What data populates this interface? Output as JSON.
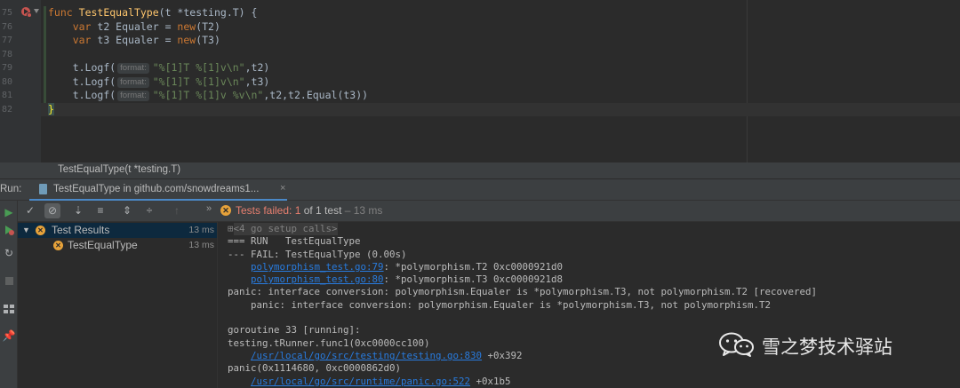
{
  "editor": {
    "line_numbers": [
      "75",
      "76",
      "77",
      "78",
      "79",
      "80",
      "81",
      "82"
    ],
    "line75": {
      "kw": "func",
      "name": "TestEqualType",
      "params": "(t *testing.T) {"
    },
    "line76": {
      "indent": "    ",
      "kw": "var",
      "rest": " t2 Equaler = ",
      "new": "new",
      "arg": "(T2)"
    },
    "line77": {
      "indent": "    ",
      "kw": "var",
      "rest": " t3 Equaler = ",
      "new": "new",
      "arg": "(T3)"
    },
    "line79": {
      "indent": "    ",
      "call": "t.Logf(",
      "hint": "format:",
      "str": "\"%[1]T %[1]v\\n\"",
      "tail": ",t2)"
    },
    "line80": {
      "indent": "    ",
      "call": "t.Logf(",
      "hint": "format:",
      "str": "\"%[1]T %[1]v\\n\"",
      "tail": ",t3)"
    },
    "line81": {
      "indent": "    ",
      "call": "t.Logf(",
      "hint": "format:",
      "str": "\"%[1]T %[1]v %v\\n\"",
      "tail": ",t2,t2.Equal(t3))"
    },
    "line82": {
      "brace": "}"
    }
  },
  "breadcrumb": {
    "text": "TestEqualType(t *testing.T)"
  },
  "run_panel": {
    "label": "Run:",
    "tab_label": "TestEqualType in github.com/snowdreams1...",
    "tab_close": "×"
  },
  "status": {
    "expand": "»",
    "failed_text": "Tests failed: 1",
    "count_text": " of 1 test",
    "duration_text": " – 13 ms"
  },
  "tree": {
    "root": {
      "label": "Test Results",
      "time": "13 ms"
    },
    "child": {
      "label": "TestEqualType",
      "time": "13 ms"
    }
  },
  "console": {
    "fold_line": "<4 go setup calls>",
    "lines": [
      "=== RUN   TestEqualType",
      "--- FAIL: TestEqualType (0.00s)"
    ],
    "log1": {
      "link": "polymorphism_test.go:79",
      "text": ": *polymorphism.T2 0xc0000921d0"
    },
    "log2": {
      "link": "polymorphism_test.go:80",
      "text": ": *polymorphism.T3 0xc0000921d8"
    },
    "panic1": "panic: interface conversion: polymorphism.Equaler is *polymorphism.T3, not polymorphism.T2 [recovered]",
    "panic2": "    panic: interface conversion: polymorphism.Equaler is *polymorphism.T3, not polymorphism.T2",
    "goroutine": "goroutine 33 [running]:",
    "trunner": "testing.tRunner.func1(0xc0000cc100)",
    "trace1": {
      "link": "/usr/local/go/src/testing/testing.go:830",
      "text": " +0x392"
    },
    "panic_call": "panic(0x1114680, 0xc0000862d0)",
    "trace2": {
      "link": "/usr/local/go/src/runtime/panic.go:522",
      "text": " +0x1b5"
    }
  },
  "watermark": {
    "text": "雪之梦技术驿站"
  },
  "colors": {
    "background": "#2b2b2b",
    "keyword": "#cc7832",
    "function": "#ffc66d",
    "string": "#6a8759",
    "fail": "#e77f6f",
    "link": "#287bde",
    "run_green": "#499c54"
  }
}
